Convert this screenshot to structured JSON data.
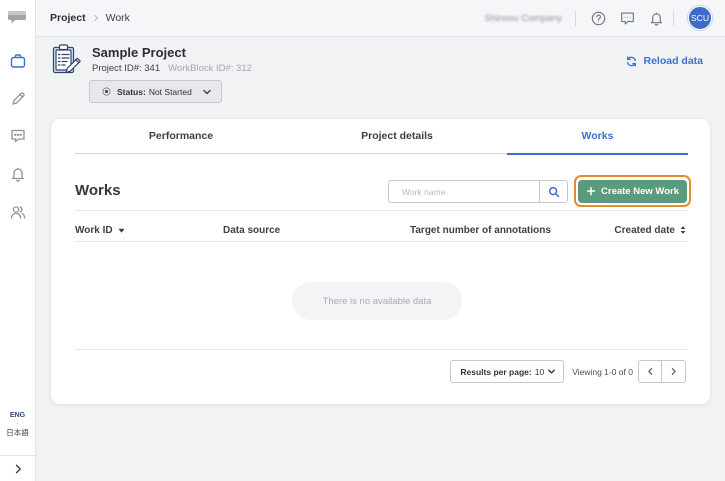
{
  "colors": {
    "accent": "#3e6fd2",
    "success": "#5b9b7d",
    "highlight": "#e38c29",
    "avatar": "#3d6bc7"
  },
  "sidebar": {
    "logo_icon": "speech-bubble-logo-icon",
    "items": [
      {
        "icon": "briefcase-icon",
        "active": true
      },
      {
        "icon": "pencil-icon",
        "active": false
      },
      {
        "icon": "message-square-icon",
        "active": false
      },
      {
        "icon": "bell-icon",
        "active": false
      },
      {
        "icon": "users-icon",
        "active": false
      }
    ],
    "language": {
      "current": "ENG",
      "separator": "·",
      "other": "日本語"
    },
    "collapse_icon": "chevron-right-icon"
  },
  "header": {
    "breadcrumb": {
      "parent": "Project",
      "current": "Work",
      "separator_icon": "chevron-right-icon"
    },
    "company": "Shinsou Company",
    "icons": [
      "question-circle-icon",
      "feedback-icon",
      "bell-icon"
    ],
    "avatar_initials": "SCU"
  },
  "project": {
    "icon": "clipboard-pencil-icon",
    "name": "Sample Project",
    "project_id": "Project ID#: 341",
    "workblock_id": "WorkBlock ID#: 312",
    "reload_label": "Reload data",
    "reload_icon": "refresh-icon",
    "status": {
      "label": "Status:",
      "value": "Not Started",
      "icon": "radio-dot-icon"
    }
  },
  "tabs": [
    {
      "label": "Performance",
      "active": false
    },
    {
      "label": "Project details",
      "active": false
    },
    {
      "label": "Works",
      "active": true
    }
  ],
  "works": {
    "title": "Works",
    "search": {
      "placeholder": "Work name",
      "value": "",
      "icon": "search-icon"
    },
    "create_label": "Create New Work",
    "create_icon": "plus-icon",
    "columns": [
      {
        "label": "Work ID",
        "sort_icon": "sort-down-icon"
      },
      {
        "label": "Data source"
      },
      {
        "label": "Target number of annotations"
      },
      {
        "label": "Created date",
        "sort_icon": "sort-both-icon"
      }
    ],
    "rows": [],
    "empty_text": "There is no available data",
    "pagination": {
      "per_page_label": "Results per page:",
      "per_page_value": "10",
      "viewing": "Viewing 1-0 of 0"
    }
  }
}
